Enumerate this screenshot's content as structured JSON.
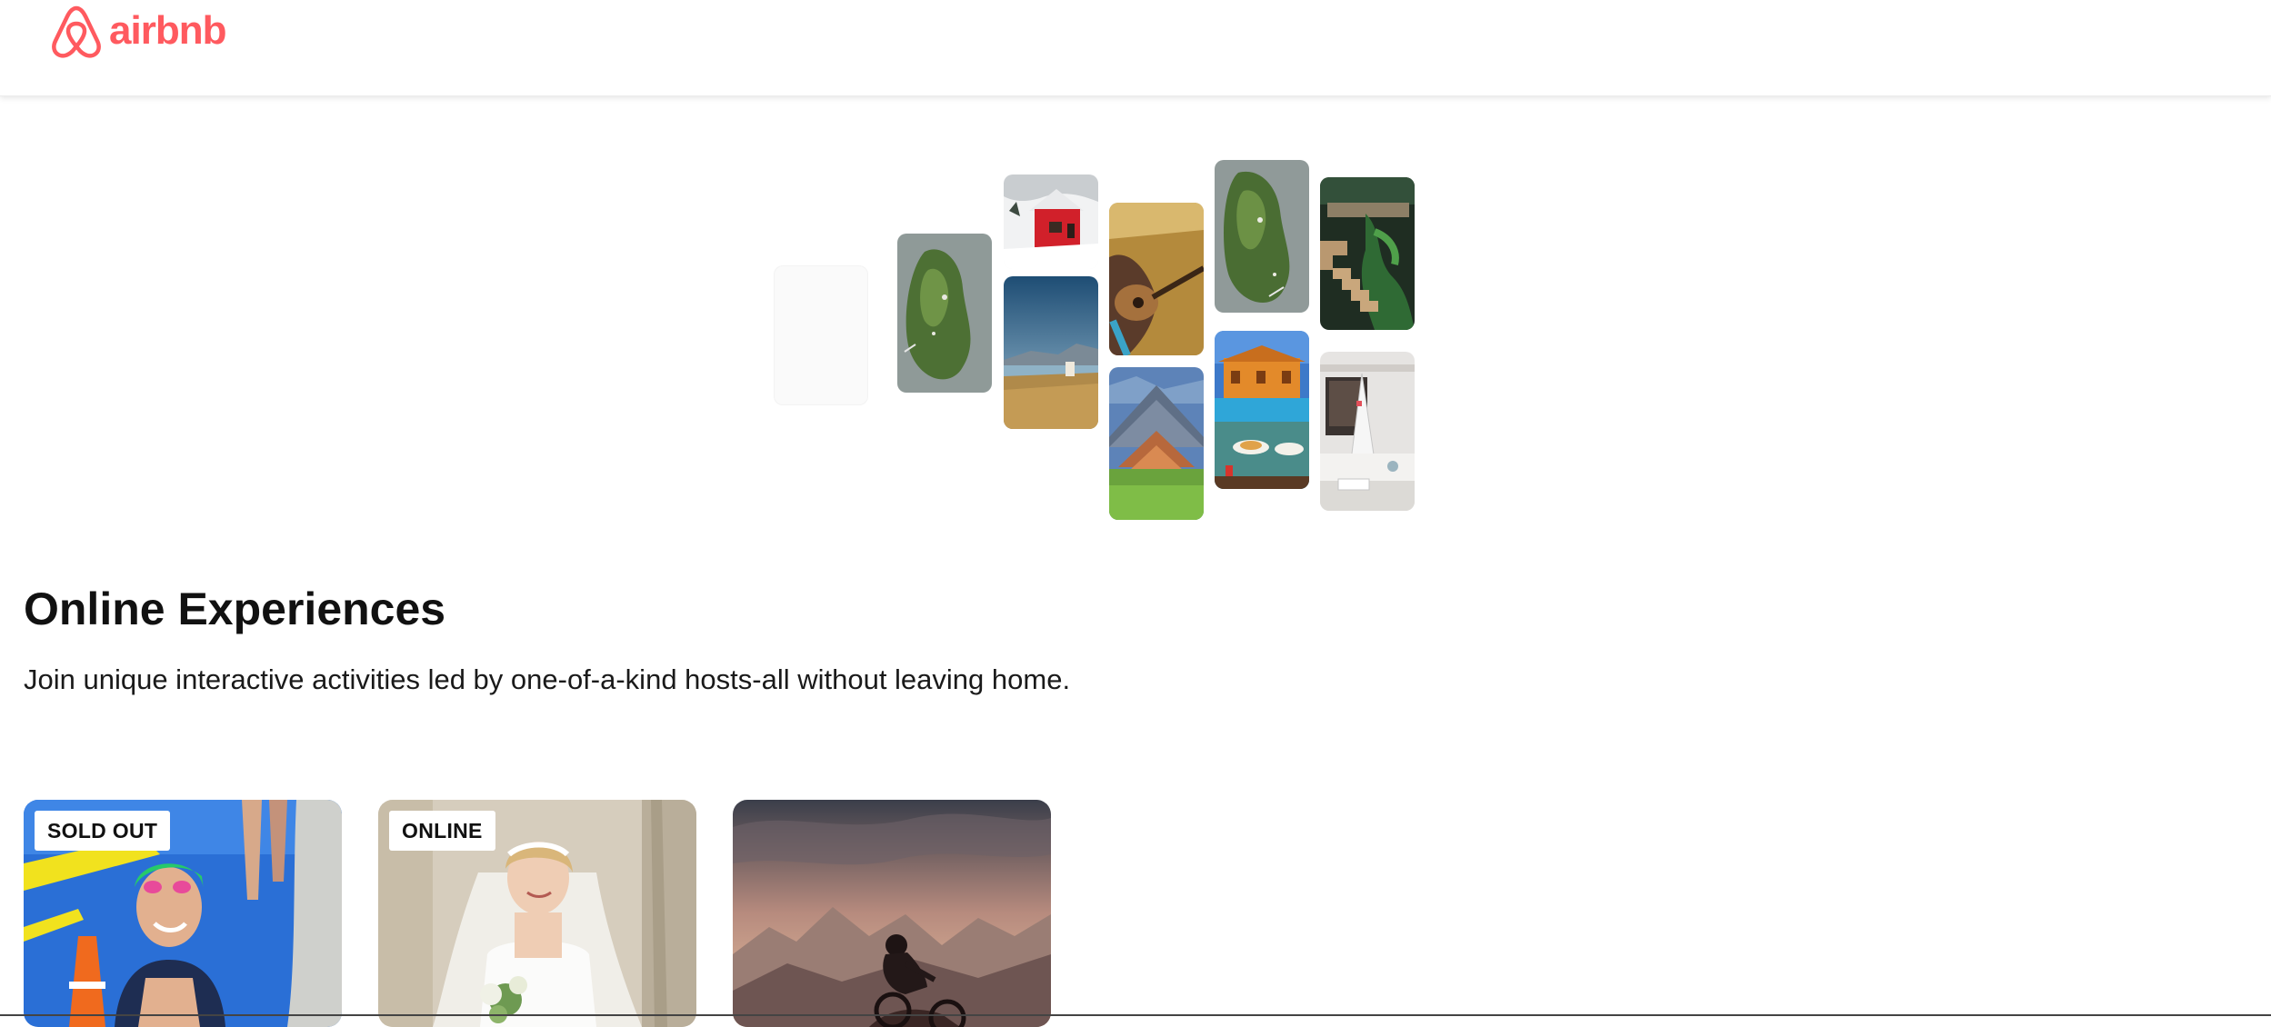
{
  "brand": {
    "name": "airbnb",
    "color": "#FF5A5F"
  },
  "header": {
    "logo_icon": "airbnb-belo-icon"
  },
  "hero": {
    "collage_images": [
      "placeholder",
      "aerial-island",
      "red-cabin-snow",
      "lake-mountains-field",
      "guitar-player-field",
      "triangle-roof-house",
      "aerial-island",
      "villa-pool-breakfast",
      "vine-stone-stairs",
      "white-interior-fireplace"
    ]
  },
  "section": {
    "title": "Online Experiences",
    "subtitle": "Join unique interactive activities led by one-of-a-kind hosts-all without leaving home."
  },
  "cards": [
    {
      "badge": "SOLD OUT",
      "image": "swimmer-triathlon"
    },
    {
      "badge": "ONLINE",
      "image": "bride-bouquet"
    },
    {
      "badge": "",
      "image": "mountain-biker-sunset"
    }
  ]
}
